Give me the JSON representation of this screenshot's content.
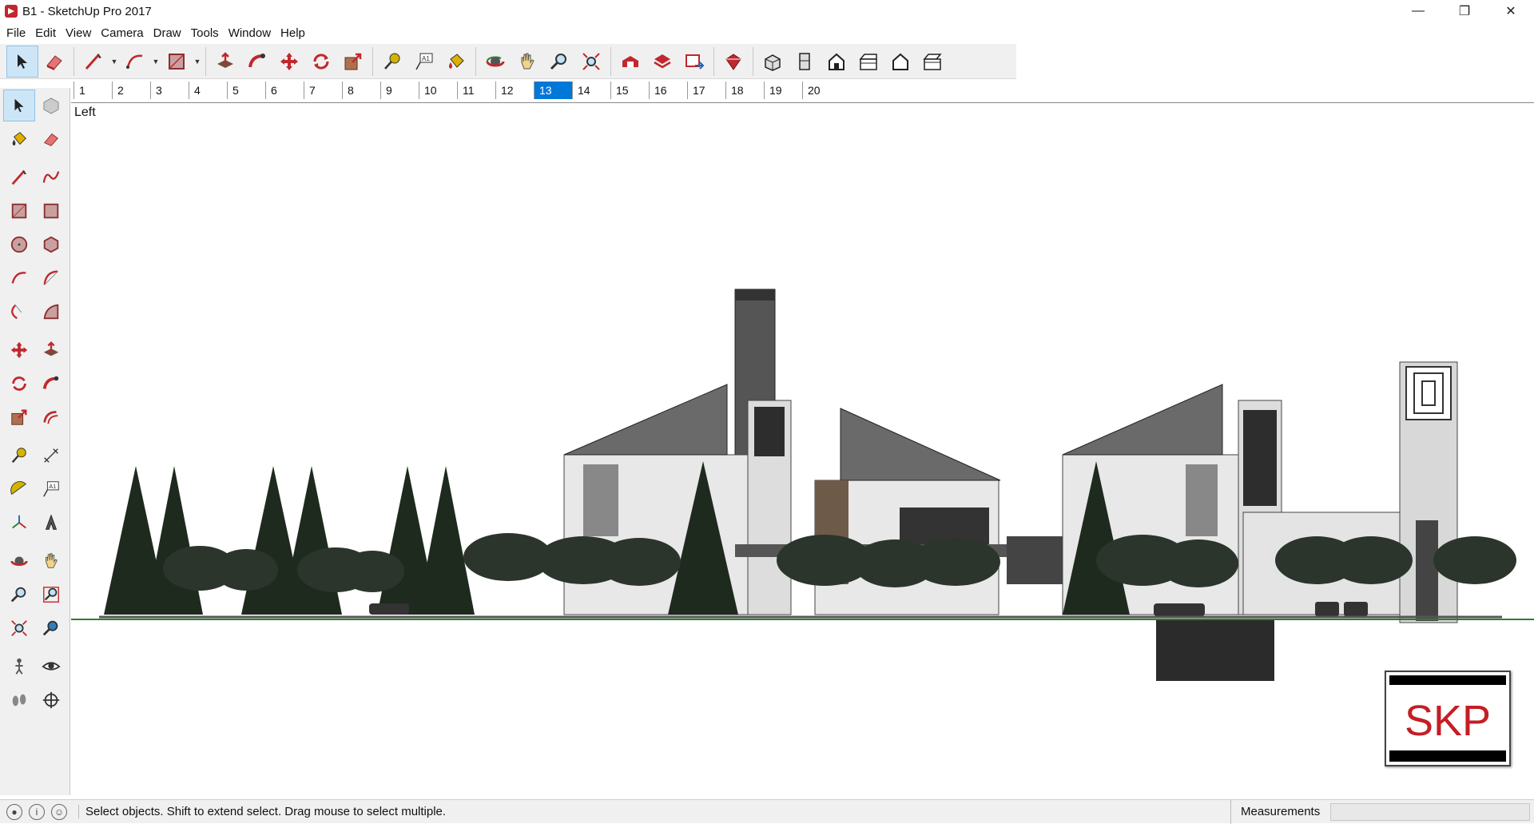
{
  "window": {
    "title": "B1 - SketchUp Pro 2017",
    "minimize": "—",
    "maximize": "❐",
    "close": "✕"
  },
  "menu": [
    "File",
    "Edit",
    "View",
    "Camera",
    "Draw",
    "Tools",
    "Window",
    "Help"
  ],
  "toolbar": {
    "items": [
      "select-icon",
      "eraser-icon",
      "line-icon",
      "arc-icon",
      "rectangle-icon",
      "push-pull-icon",
      "follow-me-icon",
      "move-icon",
      "rotate-icon",
      "scale-icon",
      "tape-measure-icon",
      "text-icon",
      "paint-bucket-icon",
      "orbit-icon",
      "pan-icon",
      "zoom-icon",
      "zoom-extents-icon",
      "warehouse-icon",
      "share-model-icon",
      "layout-icon",
      "extension-warehouse-icon",
      "iso-view-icon",
      "top-view-icon",
      "front-view-icon",
      "right-view-icon",
      "back-view-icon",
      "left-view-icon"
    ]
  },
  "scenes": {
    "tabs": [
      "1",
      "2",
      "3",
      "4",
      "5",
      "6",
      "7",
      "8",
      "9",
      "10",
      "11",
      "12",
      "13",
      "14",
      "15",
      "16",
      "17",
      "18",
      "19",
      "20"
    ],
    "active": "13"
  },
  "viewport": {
    "label": "Left",
    "logo_text": "SKP"
  },
  "status": {
    "message": "Select objects. Shift to extend select. Drag mouse to select multiple.",
    "measurements_label": "Measurements",
    "measurements_value": ""
  },
  "colors": {
    "accent": "#0078d7",
    "tool_red": "#c0282d",
    "ground_line": "#2e7d32"
  }
}
